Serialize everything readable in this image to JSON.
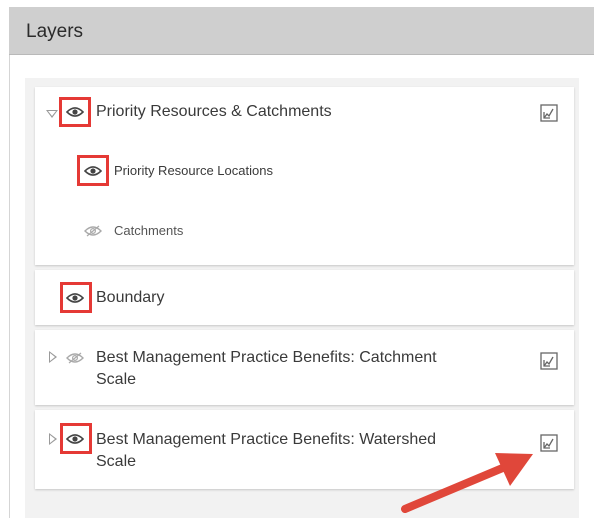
{
  "header": {
    "title": "Layers"
  },
  "layers": [
    {
      "label": "Priority Resources & Catchments",
      "visible": true,
      "expanded": true,
      "children": [
        {
          "label": "Priority Resource Locations",
          "visible": true
        },
        {
          "label": "Catchments",
          "visible": false
        }
      ]
    },
    {
      "label": "Boundary",
      "visible": true
    },
    {
      "label": "Best Management Practice Benefits: Catchment",
      "label_line2": "Scale",
      "visible": false,
      "expanded": false
    },
    {
      "label": "Best Management Practice Benefits: Watershed",
      "label_line2": "Scale",
      "visible": true,
      "expanded": false
    }
  ],
  "icons": {
    "eye": "eye-icon",
    "eye_off": "eye-off-icon",
    "legend": "legend-icon",
    "caret_down": "caret-down-icon",
    "caret_right": "caret-right-icon"
  },
  "colors": {
    "highlight": "#e53935",
    "header_bg": "#cfcfcf",
    "arrow": "#e0473a"
  }
}
